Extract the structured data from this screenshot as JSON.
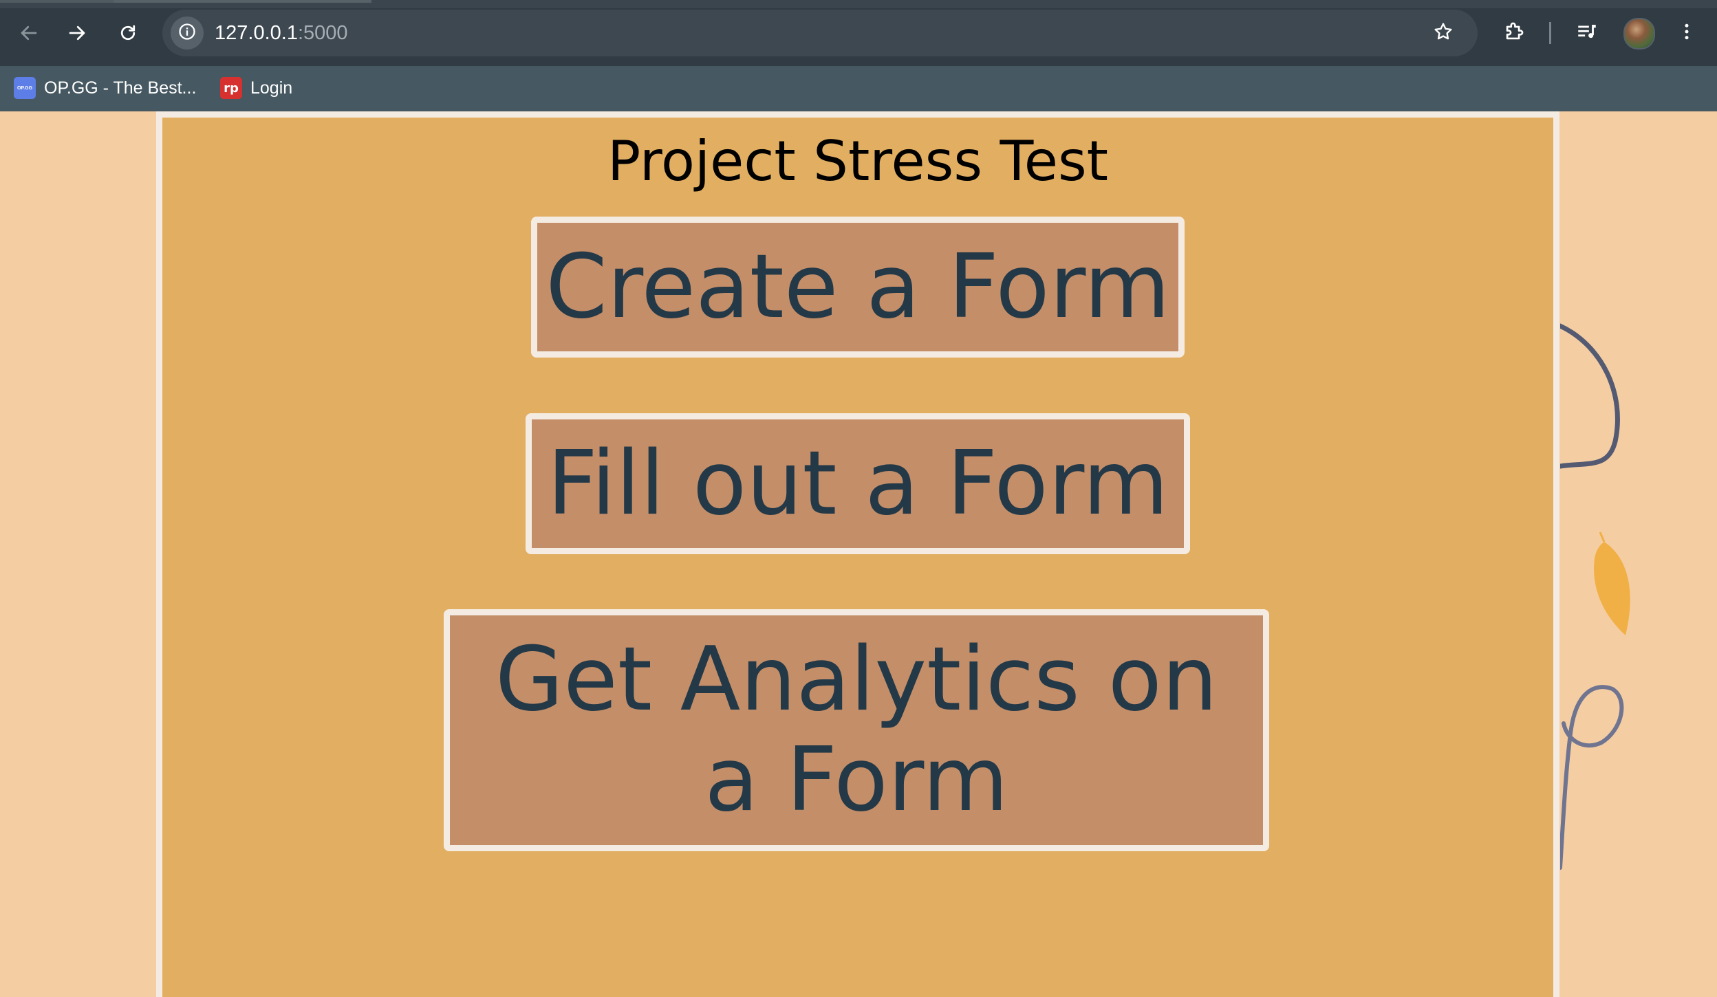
{
  "browser": {
    "url_host": "127.0.0.1",
    "url_port": ":5000",
    "icons": {
      "back": "arrow-left-icon",
      "forward": "arrow-right-icon",
      "reload": "reload-icon",
      "site_info": "info-icon",
      "bookmark_star": "star-icon",
      "extensions": "puzzle-icon",
      "media": "media-list-icon",
      "menu": "kebab-menu-icon"
    },
    "bookmarks": [
      {
        "label": "OP.GG - The Best...",
        "favicon_text": "OP.GG"
      },
      {
        "label": "Login",
        "favicon_text": "rp"
      }
    ]
  },
  "page": {
    "title": "Project Stress Test",
    "buttons": {
      "create": "Create a Form",
      "fill": "Fill out a Form",
      "analytics": "Get Analytics on a Form"
    }
  },
  "colors": {
    "page_background": "#f5cda2",
    "panel_background": "#e2ae62",
    "panel_border": "#f4ece2",
    "button_background": "#c48e69",
    "button_text": "#243947"
  }
}
